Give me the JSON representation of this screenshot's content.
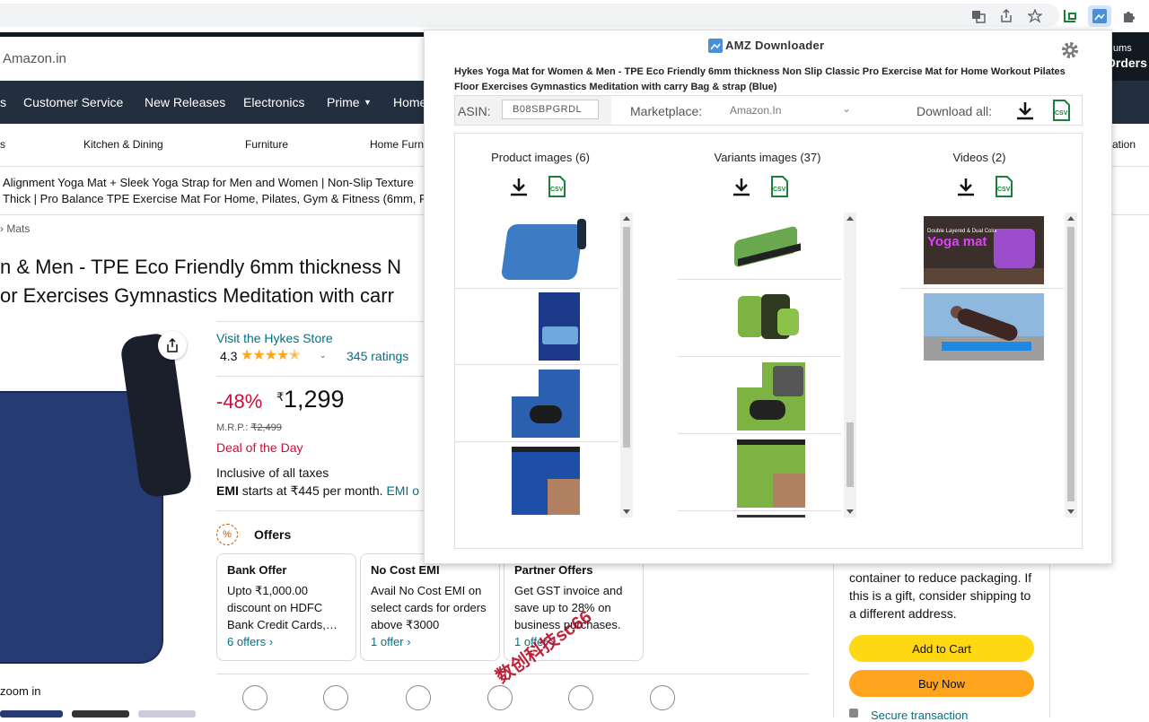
{
  "browser": {
    "extension_tooltip": "AMZ Downloader"
  },
  "amazon": {
    "domain": "Amazon.in",
    "orders": "Orders",
    "returns": "ums",
    "nav": [
      "s",
      "Customer Service",
      "New Releases",
      "Electronics",
      "Prime",
      "Home"
    ],
    "subnav": [
      "s",
      "Kitchen & Dining",
      "Furniture",
      "Home Furn",
      "ation"
    ],
    "banner_line1": "Alignment Yoga Mat + Sleek Yoga Strap for Men and Women | Non-Slip Texture",
    "banner_line2": "Thick | Pro Balance TPE Exercise Mat For Home, Pilates, Gym & Fitness (6mm, Re",
    "breadcrumb_sep": "›",
    "breadcrumb": "Mats",
    "title_line1": "n & Men - TPE Eco Friendly 6mm thickness N",
    "title_line2": "or Exercises Gymnastics Meditation with carr",
    "store_link": "Visit the Hykes Store",
    "rating": "4.3",
    "ratings_count": "345 ratings",
    "discount": "-48%",
    "currency": "₹",
    "price": "1,299",
    "mrp_label": "M.R.P.:",
    "mrp": "₹2,499",
    "deal": "Deal of the Day",
    "taxes": "Inclusive of all taxes",
    "emi_bold": "EMI",
    "emi": "starts at ₹445 per month.",
    "emi_link": "EMI o",
    "offers_title": "Offers",
    "offer_cards": [
      {
        "title": "Bank Offer",
        "text": "Upto ₹1,000.00 discount on HDFC Bank Credit Cards,…",
        "link": "6 offers ›"
      },
      {
        "title": "No Cost EMI",
        "text": "Avail No Cost EMI on select cards for orders above ₹3000",
        "link": "1 offer ›"
      },
      {
        "title": "Partner Offers",
        "text": "Get GST invoice and save up to 28% on business purchases.",
        "link": "1 offer ›"
      }
    ],
    "zoom": "zoom in",
    "gift_text": "container to reduce packaging. If this is a gift, consider shipping to a different address.",
    "add_to_cart": "Add to Cart",
    "buy_now": "Buy Now",
    "secure": "Secure transaction",
    "watermark": "数创科技sc66",
    "mat_color": "#263a73"
  },
  "popup": {
    "title": "AMZ Downloader",
    "product_title": "Hykes Yoga Mat for Women & Men - TPE Eco Friendly 6mm thickness Non Slip Classic Pro Exercise Mat for Home Workout Pilates Floor Exercises Gymnastics Meditation with carry Bag & strap (Blue)",
    "asin_label": "ASIN:",
    "asin": "B08SBPGRDL",
    "marketplace_label": "Marketplace:",
    "marketplace": "Amazon.In",
    "download_all": "Download all:",
    "columns": [
      {
        "title": "Product images (6)"
      },
      {
        "title": "Variants images (37)"
      },
      {
        "title": "Videos (2)"
      }
    ],
    "video_text1": "Double Layered & Dual Color",
    "video_text2": "Yoga mat",
    "csv": "CSV",
    "accent": "#1a7f37"
  }
}
